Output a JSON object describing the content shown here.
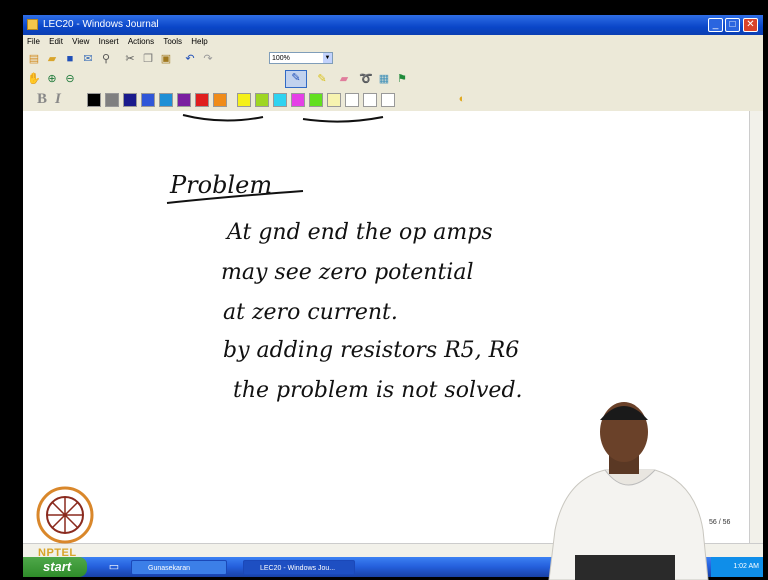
{
  "window": {
    "title": "LEC20 - Windows Journal",
    "min_glyph": "_",
    "max_glyph": "□",
    "close_glyph": "✕"
  },
  "menu": {
    "items": [
      "File",
      "Edit",
      "View",
      "Insert",
      "Actions",
      "Tools",
      "Help"
    ]
  },
  "toolbar": {
    "zoom_value": "100%",
    "bold_label": "B",
    "italic_label": "I",
    "colors": [
      "#000000",
      "#808080",
      "#1a1a8c",
      "#2f56d8",
      "#1e8fd6",
      "#7a1ea0",
      "#e01f1f",
      "#f08c1a",
      "#f5f01a",
      "#9ed622",
      "#2fd3f0",
      "#e53fe6",
      "#63e01f",
      "#f7f3b0",
      "#ffffff",
      "#ffffff",
      "#ffffff"
    ]
  },
  "note": {
    "heading": "Problem",
    "lines": [
      "At gnd end the op amps",
      "may see zero potential",
      "at zero current.",
      "by adding resistors R5, R6",
      "the problem is not solved."
    ]
  },
  "status": {
    "page_indicator": "56 / 56"
  },
  "taskbar": {
    "start_label": "start",
    "items": [
      "Gunasekaran",
      "LEC20 - Windows Jou..."
    ],
    "clock": "1:02 AM"
  },
  "branding": {
    "logo_text": "NPTEL"
  }
}
